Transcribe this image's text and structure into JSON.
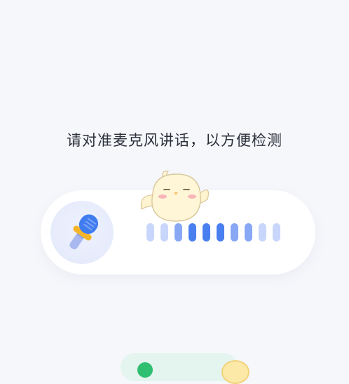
{
  "instruction": "请对准麦克风讲话，以方便检测",
  "colors": {
    "background": "#f6f7fb",
    "card": "#ffffff",
    "mic_blue": "#3f7cf0",
    "mic_ring": "#f5b52a",
    "bar_dark": "#4a7ff0",
    "bar_mid": "#88a8f5",
    "bar_light": "#c9d6fb",
    "accent_green": "#2fbf71"
  },
  "icons": {
    "mic": "microphone-icon",
    "mascot": "chick-mascot-icon"
  },
  "level_bars": [
    "light",
    "light",
    "mid",
    "dark",
    "dark",
    "dark",
    "mid",
    "mid",
    "light",
    "light"
  ]
}
